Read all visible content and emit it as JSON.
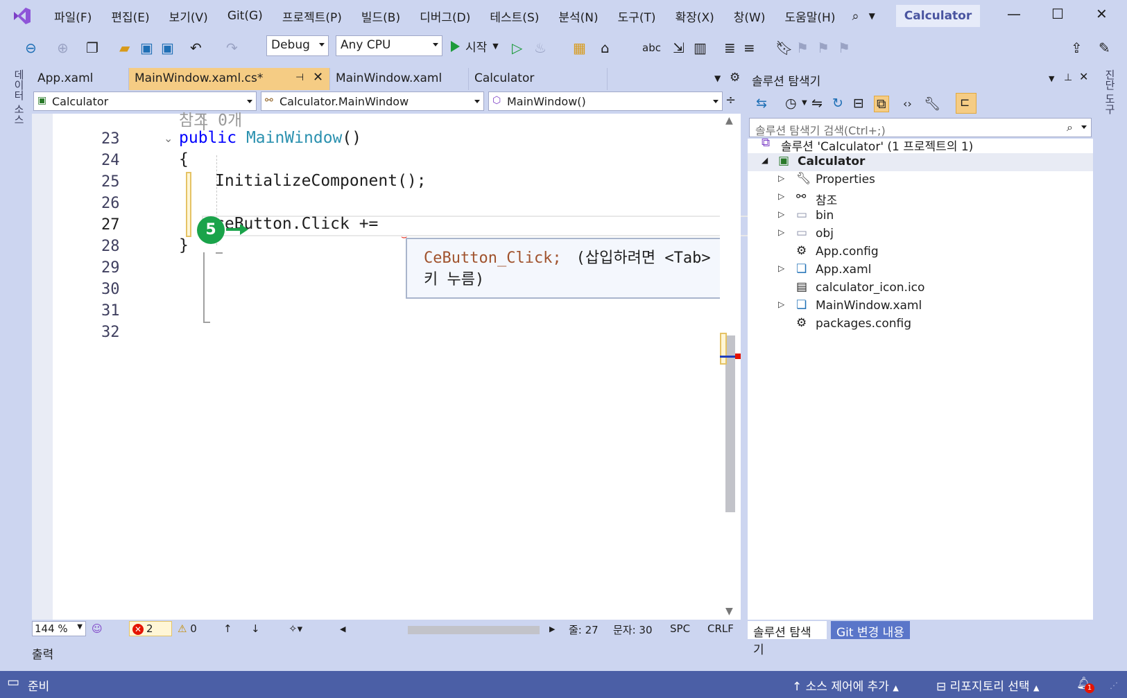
{
  "menu": {
    "items": [
      "파일(F)",
      "편집(E)",
      "보기(V)",
      "Git(G)",
      "프로젝트(P)",
      "빌드(B)",
      "디버그(D)",
      "테스트(S)",
      "분석(N)",
      "도구(T)",
      "확장(X)",
      "창(W)",
      "도움말(H)"
    ],
    "search_icon": "search-icon",
    "title_badge": "Calculator",
    "window_controls": [
      "—",
      "☐",
      "✕"
    ]
  },
  "toolbar": {
    "config": "Debug",
    "platform": "Any CPU",
    "start_label": "시작"
  },
  "side_tabs": {
    "left": "데이터 소스",
    "right": "진단 도구"
  },
  "doc_tabs": [
    {
      "label": "App.xaml",
      "active": false
    },
    {
      "label": "MainWindow.xaml.cs*",
      "active": true
    },
    {
      "label": "MainWindow.xaml",
      "active": false
    },
    {
      "label": "Calculator",
      "active": false
    }
  ],
  "nav_bar": {
    "project": "Calculator",
    "type": "Calculator.MainWindow",
    "member": "MainWindow()"
  },
  "editor": {
    "codelens": "참조 0개",
    "lines": [
      {
        "num": "23",
        "code_kw": "public ",
        "code_ty": "MainWindow",
        "code_rest": "()"
      },
      {
        "num": "24",
        "code_rest": "{"
      },
      {
        "num": "25",
        "code_rest": "InitializeComponent();"
      },
      {
        "num": "26",
        "code_rest": ""
      },
      {
        "num": "27",
        "code_rest": "ceButton.Click +="
      },
      {
        "num": "28",
        "code_rest": "}"
      },
      {
        "num": "29",
        "code_rest": ""
      },
      {
        "num": "30",
        "code_rest": ""
      },
      {
        "num": "31",
        "code_rest": ""
      },
      {
        "num": "32",
        "code_rest": ""
      }
    ],
    "step_badge": "5",
    "tooltip_code": "CeButton_Click;",
    "tooltip_hint_1": "(삽입하려면 <Tab>",
    "tooltip_hint_2": "키 누름)"
  },
  "edit_status": {
    "zoom": "144 %",
    "errors": "2",
    "warnings": "0",
    "line": "줄: 27",
    "col": "문자: 30",
    "spc": "SPC",
    "eol": "CRLF"
  },
  "solution_explorer": {
    "title": "솔루션 탐색기",
    "search_placeholder": "솔루션 탐색기 검색(Ctrl+;)",
    "tree": [
      {
        "label": "솔루션 'Calculator' (1 프로젝트의 1)",
        "indent": 0,
        "expander": "",
        "icon": "solution-icon"
      },
      {
        "label": "Calculator",
        "indent": 1,
        "expander": "◢",
        "icon": "csharp-project-icon",
        "selected": true,
        "bold": true
      },
      {
        "label": "Properties",
        "indent": 2,
        "expander": "▷",
        "icon": "wrench-icon"
      },
      {
        "label": "참조",
        "indent": 2,
        "expander": "▷",
        "icon": "references-icon"
      },
      {
        "label": "bin",
        "indent": 2,
        "expander": "▷",
        "icon": "folder-icon"
      },
      {
        "label": "obj",
        "indent": 2,
        "expander": "▷",
        "icon": "folder-icon"
      },
      {
        "label": "App.config",
        "indent": 2,
        "expander": "",
        "icon": "config-file-icon"
      },
      {
        "label": "App.xaml",
        "indent": 2,
        "expander": "▷",
        "icon": "xaml-file-icon"
      },
      {
        "label": "calculator_icon.ico",
        "indent": 2,
        "expander": "",
        "icon": "ico-file-icon"
      },
      {
        "label": "MainWindow.xaml",
        "indent": 2,
        "expander": "▷",
        "icon": "xaml-file-icon"
      },
      {
        "label": "packages.config",
        "indent": 2,
        "expander": "",
        "icon": "config-file-icon"
      }
    ],
    "bottom_tabs": [
      "솔루션 탐색기",
      "Git 변경 내용"
    ]
  },
  "output_tab": "출력",
  "status_bar": {
    "ready": "준비",
    "source_control": "소스 제어에 추가",
    "repository": "리포지토리 선택",
    "notifications": "1"
  }
}
